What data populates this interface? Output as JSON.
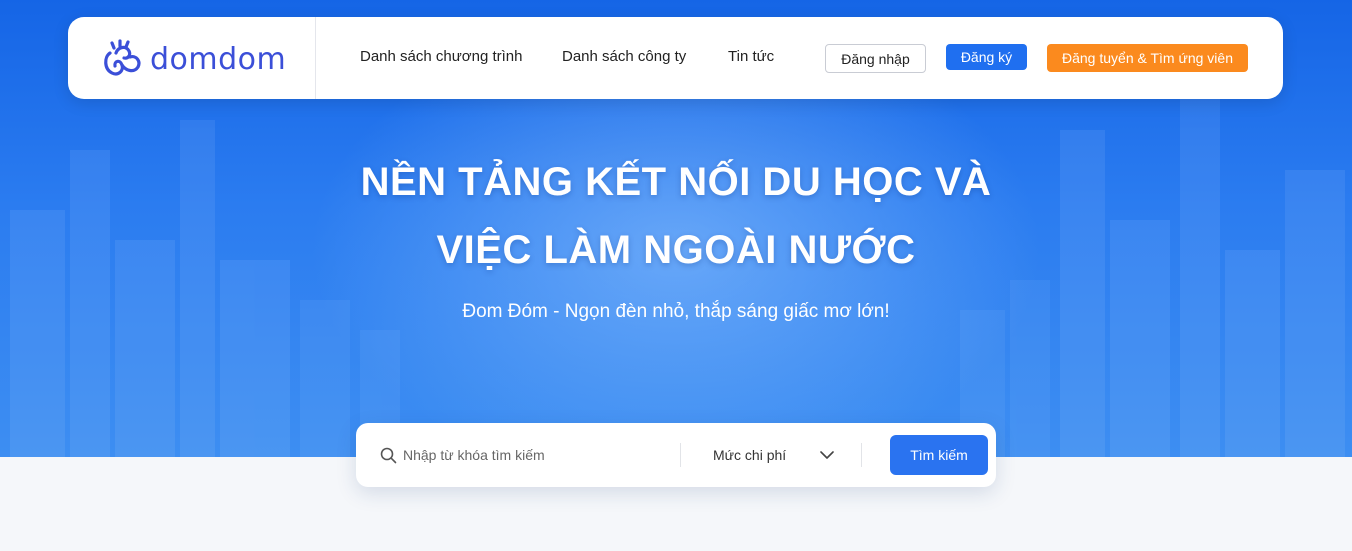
{
  "brand": {
    "name": "domdom",
    "color": "#3b4fd8"
  },
  "nav": {
    "links": [
      "Danh sách chương trình",
      "Danh sách công ty",
      "Tin tức"
    ],
    "login": "Đăng nhập",
    "register": "Đăng ký",
    "post_job": "Đăng tuyển & Tìm ứng viên"
  },
  "hero": {
    "headline_line1": "NỀN TẢNG KẾT NỐI DU HỌC VÀ",
    "headline_line2": "VIỆC LÀM NGOÀI NƯỚC",
    "subtitle": "Đom Đóm - Ngọn đèn nhỏ, thắp sáng giấc mơ lớn!"
  },
  "search": {
    "placeholder": "Nhập từ khóa tìm kiếm",
    "value": "",
    "cost_filter": "Mức chi phí",
    "submit": "Tìm kiếm"
  },
  "colors": {
    "primary": "#1f6ff0",
    "accent_orange": "#fb8a1e",
    "hero_blue": "#2b7cf0"
  },
  "icons": {
    "logo": "firefly-logo-icon",
    "search": "search-icon",
    "dropdown": "chevron-down-icon"
  }
}
